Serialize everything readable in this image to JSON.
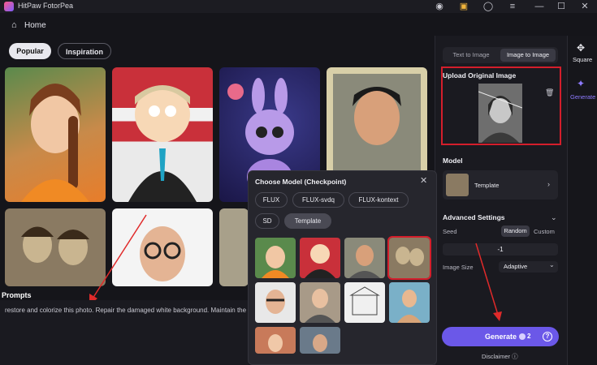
{
  "app": {
    "title": "HitPaw FotorPea"
  },
  "titlebar": {
    "icons": [
      "discord-icon",
      "shop-icon",
      "account-icon",
      "menu-icon",
      "minimize-icon",
      "maximize-icon",
      "close-icon"
    ]
  },
  "nav": {
    "home_label": "Home"
  },
  "tabs": {
    "popular": "Popular",
    "inspiration": "Inspiration"
  },
  "prompts": {
    "title": "Prompts",
    "text": "restore and colorize this photo. Repair the damaged white background. Maintain the"
  },
  "panel": {
    "mode_tabs": {
      "text_to_image": "Text to Image",
      "image_to_image": "Image to Image"
    },
    "upload": {
      "title": "Upload Original Image"
    },
    "model": {
      "title": "Model",
      "selected": "Template"
    },
    "advanced": {
      "title": "Advanced Settings",
      "seed_label": "Seed",
      "seed_random": "Random",
      "seed_custom": "Custom",
      "seed_value": "-1",
      "image_size_label": "Image Size",
      "image_size_value": "Adaptive"
    },
    "generate": {
      "label": "Generate",
      "cost": "2"
    },
    "disclaimer": "Disclaimer"
  },
  "rail": {
    "square": "Square",
    "generate": "Generate"
  },
  "modal": {
    "title": "Choose Model (Checkpoint)",
    "chips": [
      "FLUX",
      "FLUX-svdq",
      "FLUX-kontext",
      "SD",
      "Template"
    ],
    "selected_chip": "Template"
  },
  "colors": {
    "accent": "#6b58e8",
    "highlight_red": "#d41e2b",
    "bg": "#15151a"
  }
}
